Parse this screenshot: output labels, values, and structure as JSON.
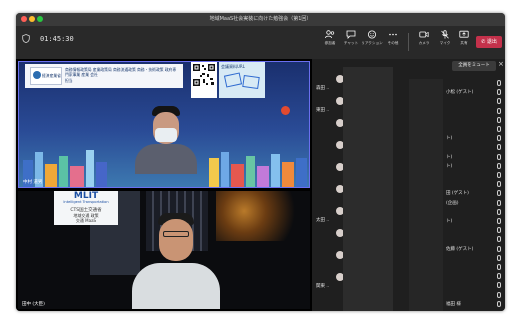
{
  "window": {
    "title": "地域MaaS社会実装に向けた勉強会（第1回）"
  },
  "toolbar": {
    "timer": "01:45:30",
    "buttons": [
      {
        "label": "参加者",
        "icon": "people-icon"
      },
      {
        "label": "チャット",
        "icon": "chat-icon"
      },
      {
        "label": "リアクション",
        "icon": "reaction-icon"
      },
      {
        "label": "その他",
        "icon": "more-icon"
      },
      {
        "label": "カメラ",
        "icon": "camera-icon"
      },
      {
        "label": "マイク",
        "icon": "mic-icon"
      },
      {
        "label": "共有",
        "icon": "share-icon"
      }
    ],
    "leave_label": "退出"
  },
  "tile1": {
    "ministry": "経済産業省",
    "department_line": "商務情報政策局 産業政策局 商務流通政策 商務・技術政策 政府専門家事業 産業 会社",
    "org_short": "担当",
    "qr_caption": "会議資料URL",
    "name": "中村 道男"
  },
  "tile2": {
    "board_logo": "MLIT",
    "board_sub": "Intelligent Transportation",
    "board_line1": "CTS国土交通省",
    "board_line2": "地域交通 政策",
    "board_line3": "交通 MaaS",
    "name": "田中 (大臣)"
  },
  "panel": {
    "mute_all_label": "全員をミュート",
    "left_names": [
      "森田 ..",
      "東田 ..",
      "",
      "",
      "",
      "",
      "太田 ..",
      "",
      "",
      "関東 .."
    ],
    "right_names": [
      "",
      "小松 (ゲスト)",
      "",
      "",
      "",
      "",
      "ト)",
      "",
      "ト)",
      "ト)",
      "",
      "",
      "田 (ゲスト)",
      "(企画)",
      "",
      "ト)",
      "",
      "",
      "佐藤 (ゲスト)",
      "",
      "",
      "",
      "",
      "",
      "福田 様"
    ]
  }
}
